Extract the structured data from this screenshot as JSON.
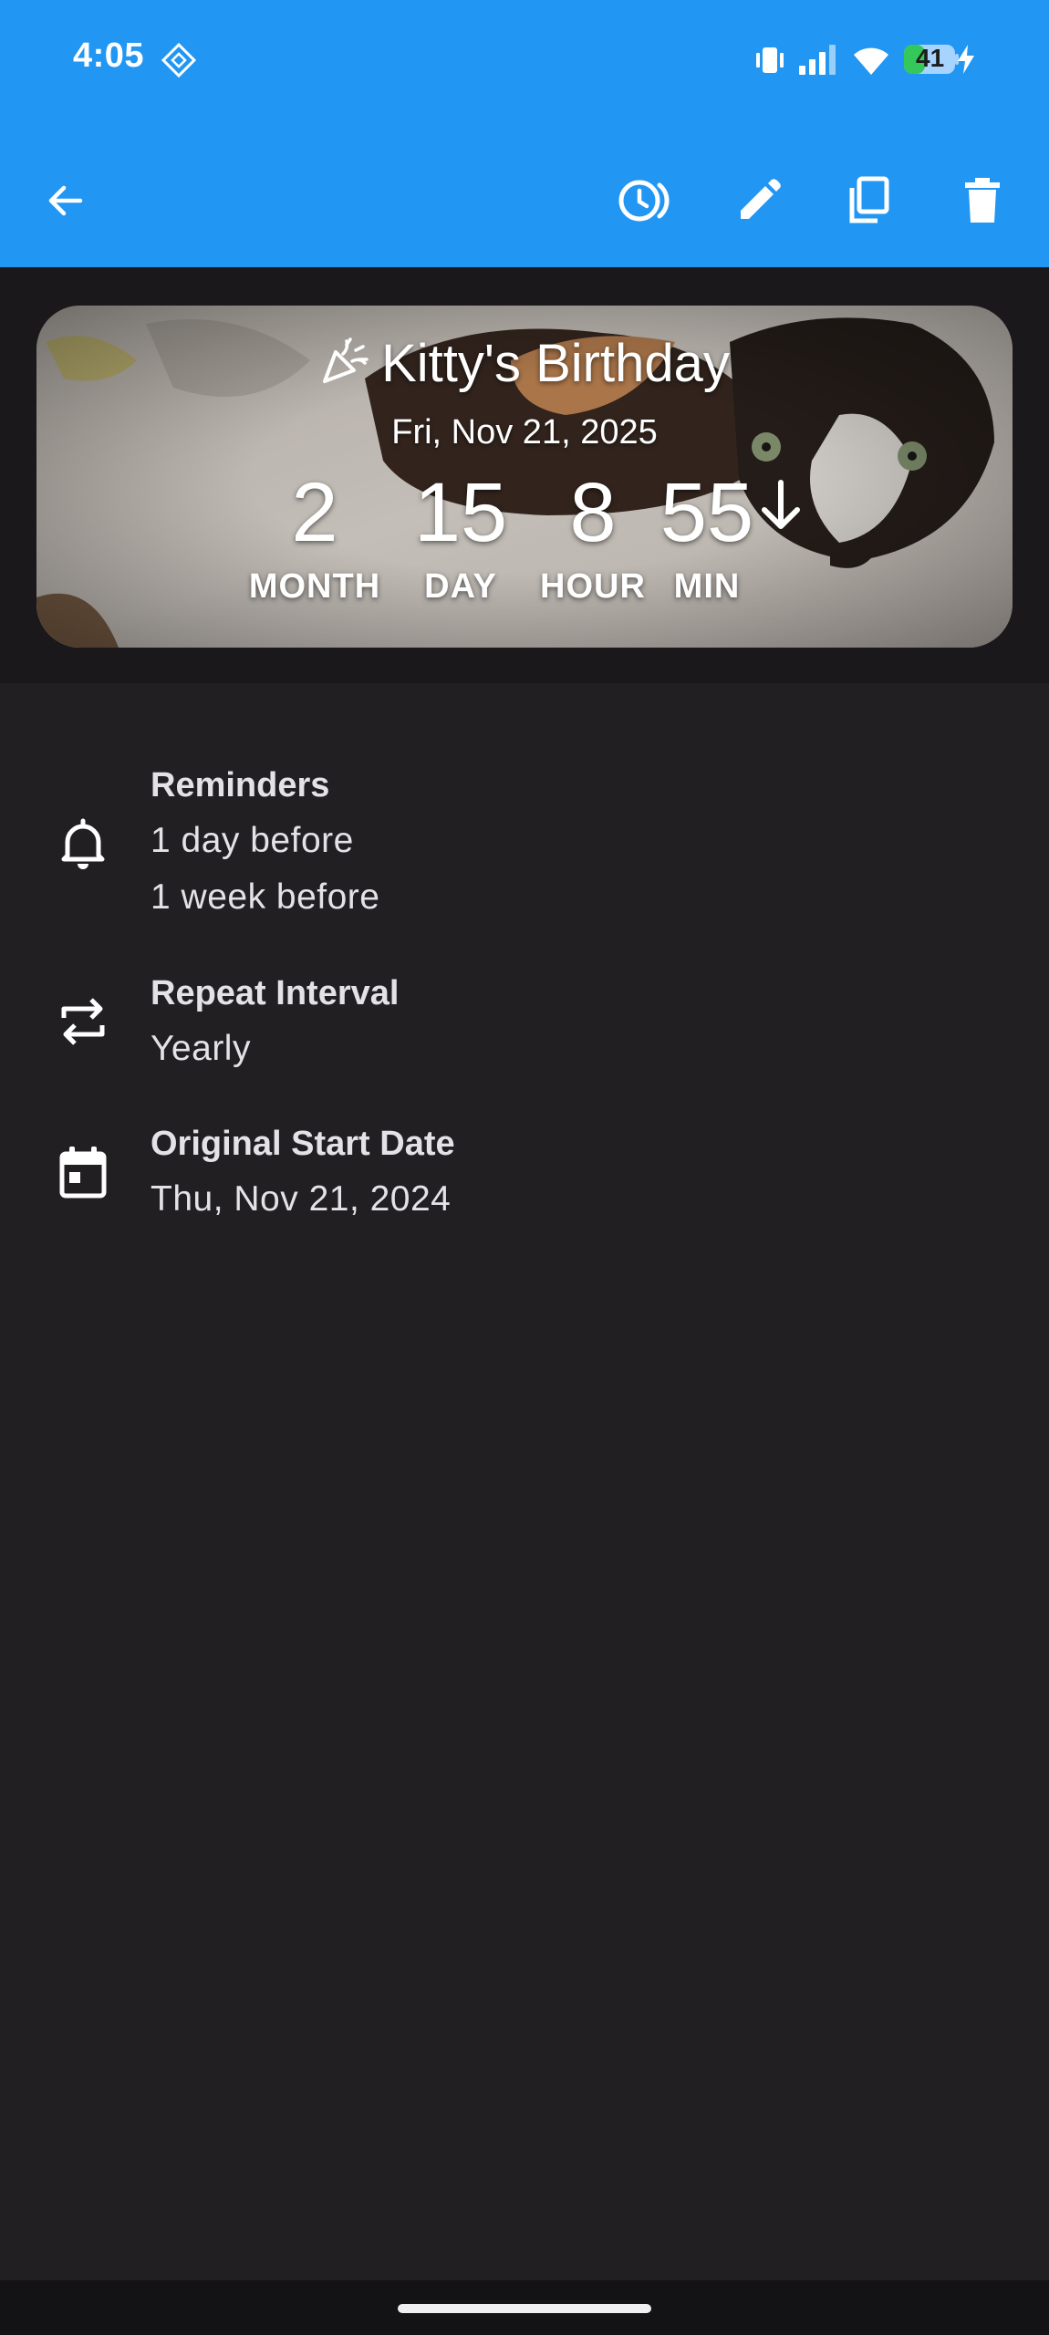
{
  "status_bar": {
    "time": "4:05",
    "battery": "41",
    "icons": [
      "location-diamond-icon",
      "vibrate-icon",
      "signal-icon",
      "wifi-icon",
      "battery-icon",
      "charging-icon"
    ]
  },
  "toolbar": {
    "actions": [
      {
        "name": "back-arrow-icon"
      },
      {
        "name": "history-icon"
      },
      {
        "name": "edit-pencil-icon"
      },
      {
        "name": "copy-icon"
      },
      {
        "name": "delete-trash-icon"
      }
    ]
  },
  "event_card": {
    "title": "Kitty's Birthday",
    "date": "Fri, Nov 21, 2025",
    "countdown": [
      {
        "value": "2",
        "label": "MONTH"
      },
      {
        "value": "15",
        "label": "DAY"
      },
      {
        "value": "8",
        "label": "HOUR"
      },
      {
        "value": "55",
        "label": "MIN"
      }
    ],
    "direction_icon": "arrow-down-icon"
  },
  "details": {
    "reminders": {
      "title": "Reminders",
      "lines": [
        "1 day before",
        "1 week before"
      ],
      "icon": "bell-icon"
    },
    "repeat": {
      "title": "Repeat Interval",
      "value": "Yearly",
      "icon": "repeat-icon"
    },
    "start_date": {
      "title": "Original Start Date",
      "value": "Thu, Nov 21, 2024",
      "icon": "calendar-icon"
    }
  },
  "colors": {
    "app_bar": "#2196f3",
    "background": "#211f22",
    "header_band": "#1a181b",
    "text": "#e4e2e6",
    "battery_fill": "#34c759"
  }
}
